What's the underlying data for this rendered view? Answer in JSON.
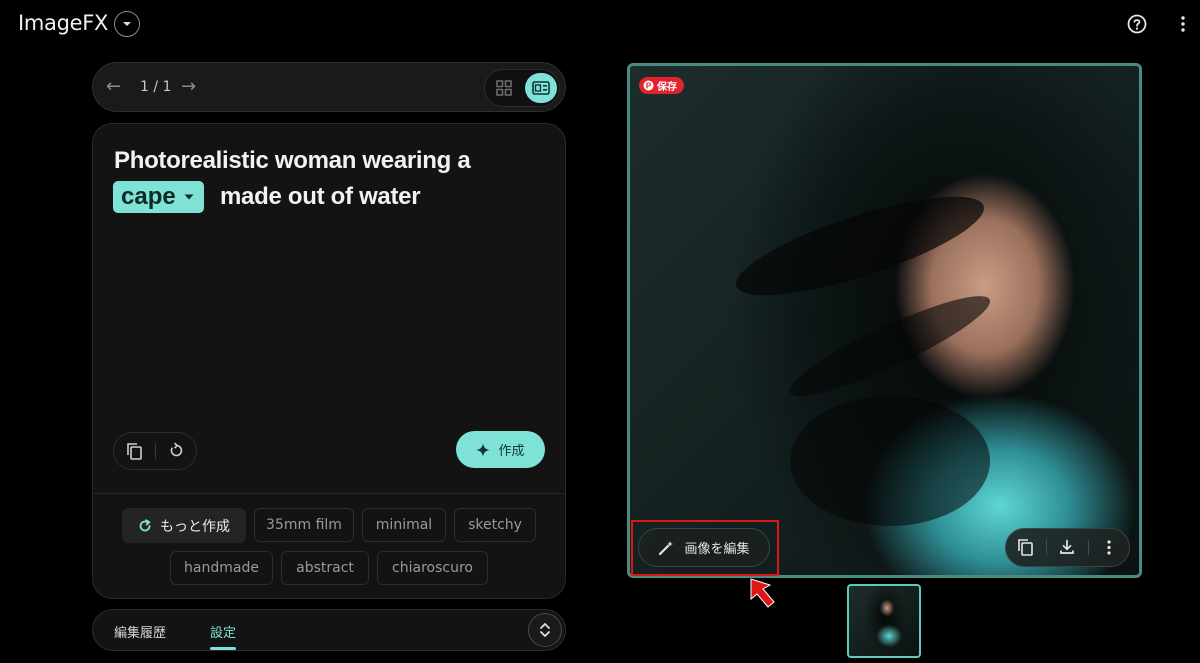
{
  "header": {
    "app_title": "ImageFX",
    "title_menu_icon": "caret-down-icon",
    "help_icon": "help-circle-icon",
    "menu_icon": "more-vert-icon"
  },
  "navigator": {
    "page_indicator": "1 / 1"
  },
  "prompt": {
    "line1": "Photorealistic woman wearing a",
    "chip_label": "cape",
    "line2_rest": "made out of water"
  },
  "actions": {
    "create_label": "作成"
  },
  "suggestions": {
    "more_label": "もっと作成",
    "chips": [
      "35mm film",
      "minimal",
      "sketchy",
      "handmade",
      "abstract",
      "chiaroscuro"
    ]
  },
  "bottom_tabs": {
    "history_label": "編集履歴",
    "settings_label": "設定"
  },
  "image_panel": {
    "pinterest_label": "保存",
    "edit_image_label": "画像を編集"
  },
  "colors": {
    "accent": "#7ee3d6",
    "frame": "#4b8a82",
    "highlight_red": "#e01616"
  }
}
